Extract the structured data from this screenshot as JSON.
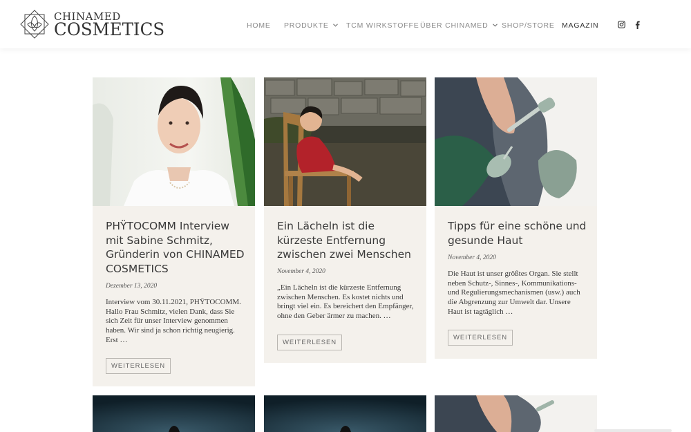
{
  "logo": {
    "top": "CHINAMED",
    "bottom": "COSMETICS"
  },
  "nav": {
    "items": [
      {
        "label": "HOME"
      },
      {
        "label": "PRODUKTE"
      },
      {
        "label": "TCM WIRKSTOFFE"
      },
      {
        "label": "ÜBER CHINAMED"
      },
      {
        "label": "SHOP/STORE"
      },
      {
        "label": "MAGAZIN"
      }
    ],
    "social": [
      "instagram-icon",
      "facebook-icon"
    ]
  },
  "cards": [
    {
      "title": "PHŸTOCOMM Interview mit Sabine Schmitz, Gründerin von CHINAMED COSMETICS",
      "date": "Dezember 13, 2020",
      "excerpt": "Interview vom 30.11.2021, PHŸTOCOMM. Hallo Frau Schmitz, vielen Dank, dass Sie sich Zeit für unser Interview genommen haben. Wir sind ja schon richtig neugierig. Erst …",
      "button": "WEITERLESEN"
    },
    {
      "title": "Ein Lächeln ist die kürzeste Entfernung zwischen zwei Menschen",
      "date": "November 4, 2020",
      "excerpt": "„Ein Lächeln ist die kürzeste Entfernung zwischen Menschen. Es kostet nichts und bringt viel ein. Es bereichert den Empfänger, ohne den Geber ärmer zu machen. …",
      "button": "WEITERLESEN"
    },
    {
      "title": "Tipps für eine schöne und gesunde Haut",
      "date": "November 4, 2020",
      "excerpt": "Die Haut ist unser größtes Organ. Sie stellt neben Schutz-, Sinnes-, Kommunikations- und Regulierungsmechanismen (usw.) auch die Abgrenzung zur Umwelt dar. Unsere Haut ist tagtäglich …",
      "button": "WEITERLESEN"
    }
  ],
  "colors": {
    "card_bg": "#f4f1ec",
    "text": "#3a3a3a",
    "nav": "#8a8a8a",
    "nav_active": "#333333"
  }
}
